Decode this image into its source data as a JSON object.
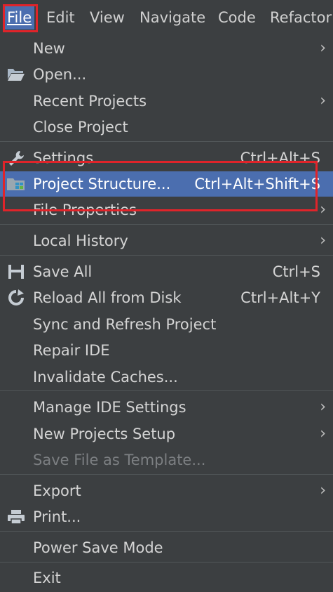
{
  "menubar": {
    "items": [
      {
        "label": "File",
        "active": true
      },
      {
        "label": "Edit"
      },
      {
        "label": "View"
      },
      {
        "label": "Navigate"
      },
      {
        "label": "Code"
      },
      {
        "label": "Refactor"
      }
    ]
  },
  "file_menu": {
    "items": [
      {
        "label": "New",
        "submenu": true
      },
      {
        "label": "Open...",
        "icon": "folder-open-icon"
      },
      {
        "label": "Recent Projects",
        "submenu": true
      },
      {
        "label": "Close Project"
      },
      {
        "label": "Settings...",
        "shortcut": "Ctrl+Alt+S",
        "icon": "wrench-icon"
      },
      {
        "label": "Project Structure...",
        "shortcut": "Ctrl+Alt+Shift+S",
        "icon": "project-structure-icon",
        "selected": true
      },
      {
        "label": "File Properties",
        "submenu": true
      },
      {
        "label": "Local History",
        "submenu": true
      },
      {
        "label": "Save All",
        "shortcut": "Ctrl+S",
        "icon": "save-icon"
      },
      {
        "label": "Reload All from Disk",
        "shortcut": "Ctrl+Alt+Y",
        "icon": "reload-icon"
      },
      {
        "label": "Sync and Refresh Project"
      },
      {
        "label": "Repair IDE"
      },
      {
        "label": "Invalidate Caches..."
      },
      {
        "label": "Manage IDE Settings",
        "submenu": true
      },
      {
        "label": "New Projects Setup",
        "submenu": true
      },
      {
        "label": "Save File as Template...",
        "disabled": true
      },
      {
        "label": "Export",
        "submenu": true
      },
      {
        "label": "Print...",
        "icon": "printer-icon"
      },
      {
        "label": "Power Save Mode"
      },
      {
        "label": "Exit"
      }
    ]
  },
  "colors": {
    "background": "#3c3f41",
    "selection": "#4b6eaf",
    "annotation_box": "#e0242a",
    "disabled_text": "#7c7f82"
  }
}
